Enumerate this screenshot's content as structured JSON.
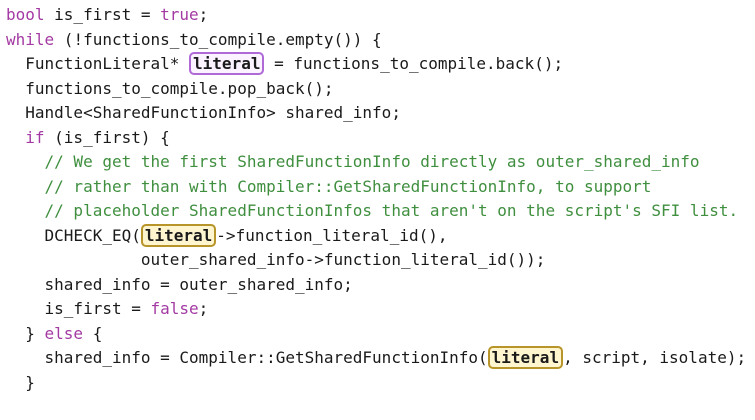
{
  "code_lines": [
    {
      "indent": "",
      "segments": [
        {
          "t": "bool",
          "c": "kw"
        },
        {
          "t": " is_first = ",
          "c": "plain"
        },
        {
          "t": "true",
          "c": "lit"
        },
        {
          "t": ";",
          "c": "plain"
        }
      ]
    },
    {
      "indent": "",
      "segments": [
        {
          "t": "while",
          "c": "kw"
        },
        {
          "t": " (!functions_to_compile.empty()) {",
          "c": "plain"
        }
      ]
    },
    {
      "indent": "  ",
      "segments": [
        {
          "t": "FunctionLiteral* ",
          "c": "plain"
        },
        {
          "t": "literal",
          "c": "hl-purple"
        },
        {
          "t": " = functions_to_compile.back();",
          "c": "plain"
        }
      ]
    },
    {
      "indent": "  ",
      "segments": [
        {
          "t": "functions_to_compile.pop_back();",
          "c": "plain"
        }
      ]
    },
    {
      "indent": "  ",
      "segments": [
        {
          "t": "Handle<SharedFunctionInfo> shared_info;",
          "c": "plain"
        }
      ]
    },
    {
      "indent": "  ",
      "segments": [
        {
          "t": "if",
          "c": "kw"
        },
        {
          "t": " (is_first) {",
          "c": "plain"
        }
      ]
    },
    {
      "indent": "    ",
      "segments": [
        {
          "t": "// We get the first SharedFunctionInfo directly as outer_shared_info",
          "c": "cm"
        }
      ]
    },
    {
      "indent": "    ",
      "segments": [
        {
          "t": "// rather than with Compiler::GetSharedFunctionInfo, to support",
          "c": "cm"
        }
      ]
    },
    {
      "indent": "    ",
      "segments": [
        {
          "t": "// placeholder SharedFunctionInfos that aren't on the script's SFI list.",
          "c": "cm"
        }
      ]
    },
    {
      "indent": "    ",
      "segments": [
        {
          "t": "DCHECK_EQ(",
          "c": "plain"
        },
        {
          "t": "literal",
          "c": "hl-gold"
        },
        {
          "t": "->function_literal_id(),",
          "c": "plain"
        }
      ]
    },
    {
      "indent": "              ",
      "segments": [
        {
          "t": "outer_shared_info->function_literal_id());",
          "c": "plain"
        }
      ]
    },
    {
      "indent": "    ",
      "segments": [
        {
          "t": "shared_info = outer_shared_info;",
          "c": "plain"
        }
      ]
    },
    {
      "indent": "    ",
      "segments": [
        {
          "t": "is_first = ",
          "c": "plain"
        },
        {
          "t": "false",
          "c": "lit"
        },
        {
          "t": ";",
          "c": "plain"
        }
      ]
    },
    {
      "indent": "  ",
      "segments": [
        {
          "t": "} ",
          "c": "plain"
        },
        {
          "t": "else",
          "c": "kw"
        },
        {
          "t": " {",
          "c": "plain"
        }
      ]
    },
    {
      "indent": "    ",
      "segments": [
        {
          "t": "shared_info = Compiler::GetSharedFunctionInfo(",
          "c": "plain"
        },
        {
          "t": "literal",
          "c": "hl-gold"
        },
        {
          "t": ", script, isolate);",
          "c": "plain"
        }
      ]
    },
    {
      "indent": "  ",
      "segments": [
        {
          "t": "}",
          "c": "plain"
        }
      ]
    }
  ],
  "colors": {
    "keyword": "#a33aa3",
    "comment": "#3f8f3f",
    "text": "#1a1a1a",
    "highlight_definition_border": "#b06ad8",
    "highlight_reference_border": "#b8952a",
    "highlight_reference_fill": "#fff6cf"
  }
}
